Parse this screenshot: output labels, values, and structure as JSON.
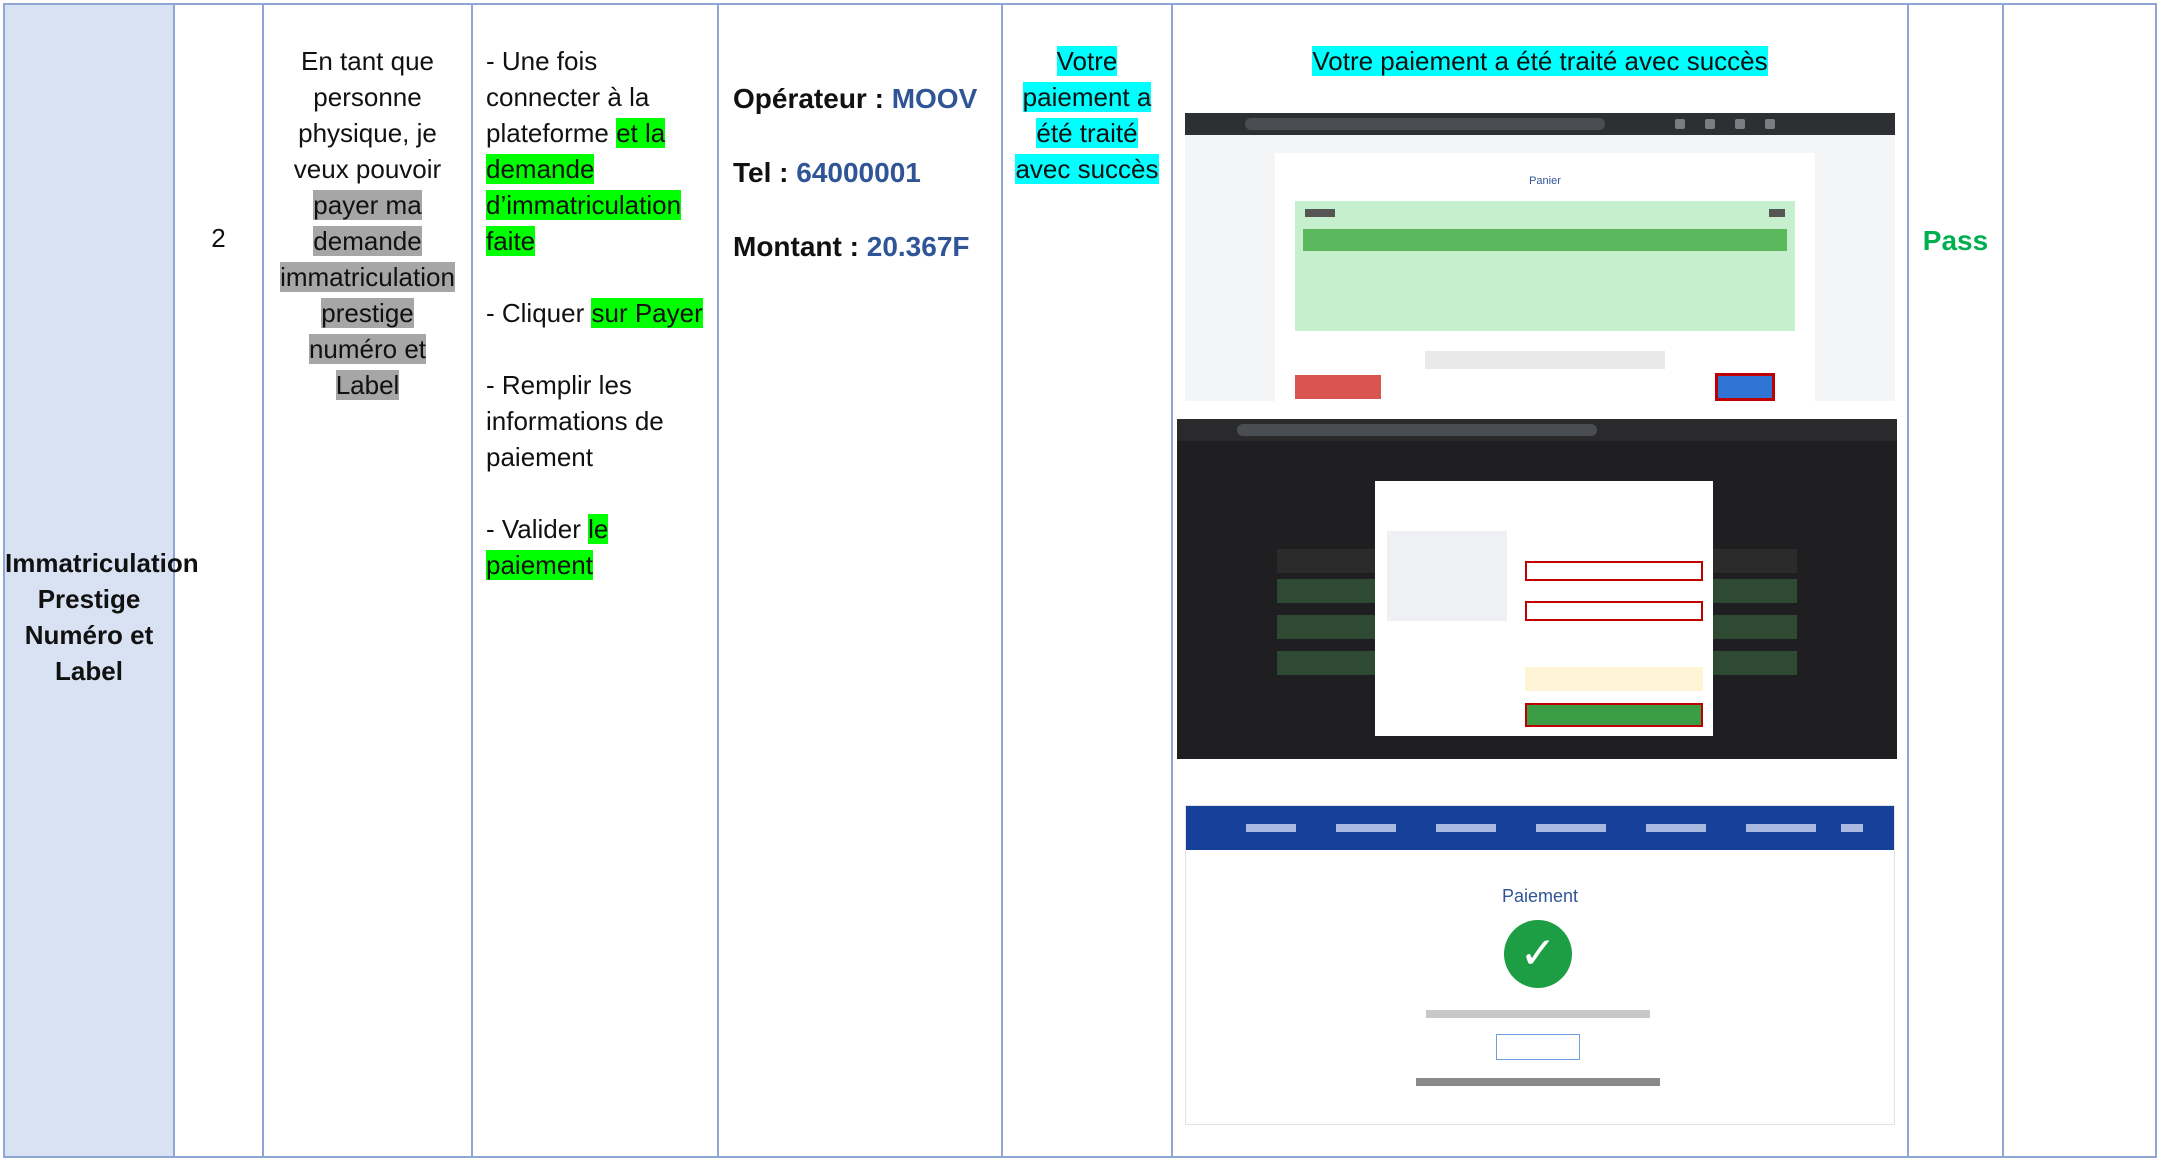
{
  "row": {
    "feature": "Immatriculation Prestige Numéro et Label",
    "number": "2",
    "story": {
      "part1": "En tant que personne physique, je veux pouvoir ",
      "highlighted": "payer ma demande immatriculation prestige numéro et Label"
    },
    "steps": [
      {
        "plain": "- Une fois connecter à la plateforme ",
        "highlighted": "et la demande d’immatriculation faite"
      },
      {
        "plain": "- Cliquer ",
        "highlighted": "sur Payer"
      },
      {
        "plain": "-  Remplir les informations de paiement",
        "highlighted": ""
      },
      {
        "plain": "- Valider ",
        "highlighted": "le paiement"
      }
    ],
    "data": {
      "operator_label": "Opérateur : ",
      "operator_value": "MOOV",
      "tel_label": "Tel : ",
      "tel_value": "64000001",
      "amount_label": "Montant : ",
      "amount_value": "20.367F"
    },
    "expected": "Votre paiement a été traité avec succès",
    "screenshot_caption": "Votre paiement a été traité avec succès",
    "status": "Pass"
  },
  "screenshots": {
    "shot1": {
      "title": "Panier"
    },
    "shot3": {
      "title": "Paiement"
    }
  },
  "colors": {
    "header_bg": "#d9e2f3",
    "border": "#8fa6d4",
    "highlight_green": "#00ff00",
    "highlight_gray": "#a6a6a6",
    "highlight_cyan": "#00ffff",
    "value_blue": "#2f5597",
    "pass_green": "#00b050"
  },
  "icons": {
    "success": "check-icon"
  }
}
